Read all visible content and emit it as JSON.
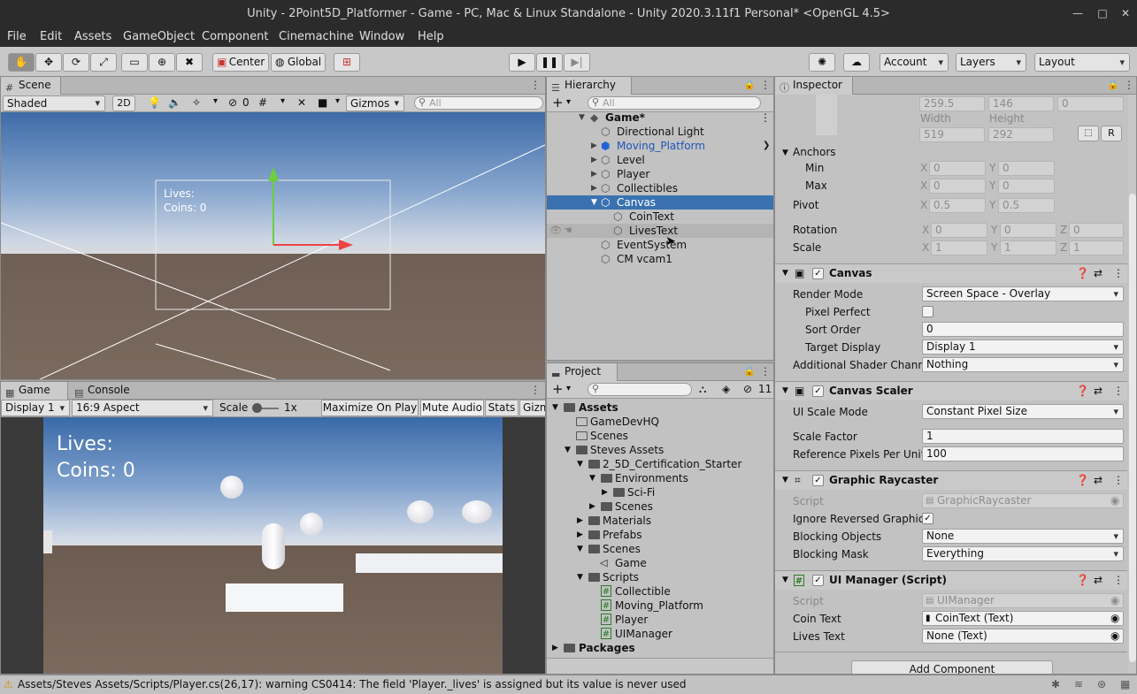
{
  "window": {
    "title": "Unity - 2Point5D_Platformer - Game - PC, Mac & Linux Standalone - Unity 2020.3.11f1 Personal* <OpenGL 4.5>"
  },
  "menu": [
    "File",
    "Edit",
    "Assets",
    "GameObject",
    "Component",
    "Cinemachine",
    "Window",
    "Help"
  ],
  "toolbar": {
    "pivot": "Center",
    "space": "Global",
    "account": "Account",
    "layers": "Layers",
    "layout": "Layout"
  },
  "scene": {
    "tab": "Scene",
    "shading": "Shaded",
    "mode2d": "2D",
    "hidden_count": "0",
    "gizmos": "Gizmos",
    "search_placeholder": "All",
    "ui_lives": "Lives:",
    "ui_coins": "Coins: 0"
  },
  "game": {
    "tab": "Game",
    "console_tab": "Console",
    "display": "Display 1",
    "aspect": "16:9 Aspect",
    "scale_label": "Scale",
    "scale_value": "1x",
    "maximize": "Maximize On Play",
    "mute": "Mute Audio",
    "stats": "Stats",
    "gizmos": "Gizm",
    "lives": "Lives:",
    "coins": "Coins: 0"
  },
  "hierarchy": {
    "tab": "Hierarchy",
    "search_placeholder": "All",
    "scene": "Game*",
    "items": [
      {
        "label": "Directional Light"
      },
      {
        "label": "Moving_Platform"
      },
      {
        "label": "Level"
      },
      {
        "label": "Player"
      },
      {
        "label": "Collectibles"
      },
      {
        "label": "Canvas"
      },
      {
        "label": "CoinText"
      },
      {
        "label": "LivesText"
      },
      {
        "label": "EventSystem"
      },
      {
        "label": "CM vcam1"
      }
    ]
  },
  "project": {
    "tab": "Project",
    "hidden_count": "11",
    "items": [
      {
        "label": "Assets"
      },
      {
        "label": "GameDevHQ"
      },
      {
        "label": "Scenes"
      },
      {
        "label": "Steves Assets"
      },
      {
        "label": "2_5D_Certification_Starter"
      },
      {
        "label": "Environments"
      },
      {
        "label": "Sci-Fi"
      },
      {
        "label": "Scenes"
      },
      {
        "label": "Materials"
      },
      {
        "label": "Prefabs"
      },
      {
        "label": "Scenes"
      },
      {
        "label": "Game"
      },
      {
        "label": "Scripts"
      },
      {
        "label": "Collectible"
      },
      {
        "label": "Moving_Platform"
      },
      {
        "label": "Player"
      },
      {
        "label": "UIManager"
      },
      {
        "label": "Packages"
      }
    ]
  },
  "inspector": {
    "tab": "Inspector",
    "pos": {
      "x": "259.5",
      "y": "146",
      "z": "0"
    },
    "width_label": "Width",
    "height_label": "Height",
    "width": "519",
    "height": "292",
    "r_btn": "R",
    "anchors_label": "Anchors",
    "min_label": "Min",
    "max_label": "Max",
    "anchor_min": {
      "x": "0",
      "y": "0"
    },
    "anchor_max": {
      "x": "0",
      "y": "0"
    },
    "pivot_label": "Pivot",
    "pivot": {
      "x": "0.5",
      "y": "0.5"
    },
    "rotation_label": "Rotation",
    "rotation": {
      "x": "0",
      "y": "0",
      "z": "0"
    },
    "scale_label": "Scale",
    "scale": {
      "x": "1",
      "y": "1",
      "z": "1"
    },
    "axis": {
      "x": "X",
      "y": "Y",
      "z": "Z"
    },
    "canvas": {
      "title": "Canvas",
      "render_mode_label": "Render Mode",
      "render_mode": "Screen Space - Overlay",
      "pixel_perfect_label": "Pixel Perfect",
      "sort_order_label": "Sort Order",
      "sort_order": "0",
      "target_display_label": "Target Display",
      "target_display": "Display 1",
      "shader_label": "Additional Shader Channe",
      "shader": "Nothing"
    },
    "scaler": {
      "title": "Canvas Scaler",
      "mode_label": "UI Scale Mode",
      "mode": "Constant Pixel Size",
      "factor_label": "Scale Factor",
      "factor": "1",
      "ref_label": "Reference Pixels Per Unit",
      "ref": "100"
    },
    "raycaster": {
      "title": "Graphic Raycaster",
      "script_label": "Script",
      "script": "GraphicRaycaster",
      "ignore_label": "Ignore Reversed Graphics",
      "blocking_label": "Blocking Objects",
      "blocking": "None",
      "mask_label": "Blocking Mask",
      "mask": "Everything"
    },
    "uimanager": {
      "title": "UI Manager (Script)",
      "script_label": "Script",
      "script": "UIManager",
      "coin_label": "Coin Text",
      "coin": "CoinText (Text)",
      "lives_label": "Lives Text",
      "lives": "None (Text)"
    },
    "add_component": "Add Component"
  },
  "status": {
    "message": "Assets/Steves Assets/Scripts/Player.cs(26,17): warning CS0414: The field 'Player._lives' is assigned but its value is never used"
  }
}
